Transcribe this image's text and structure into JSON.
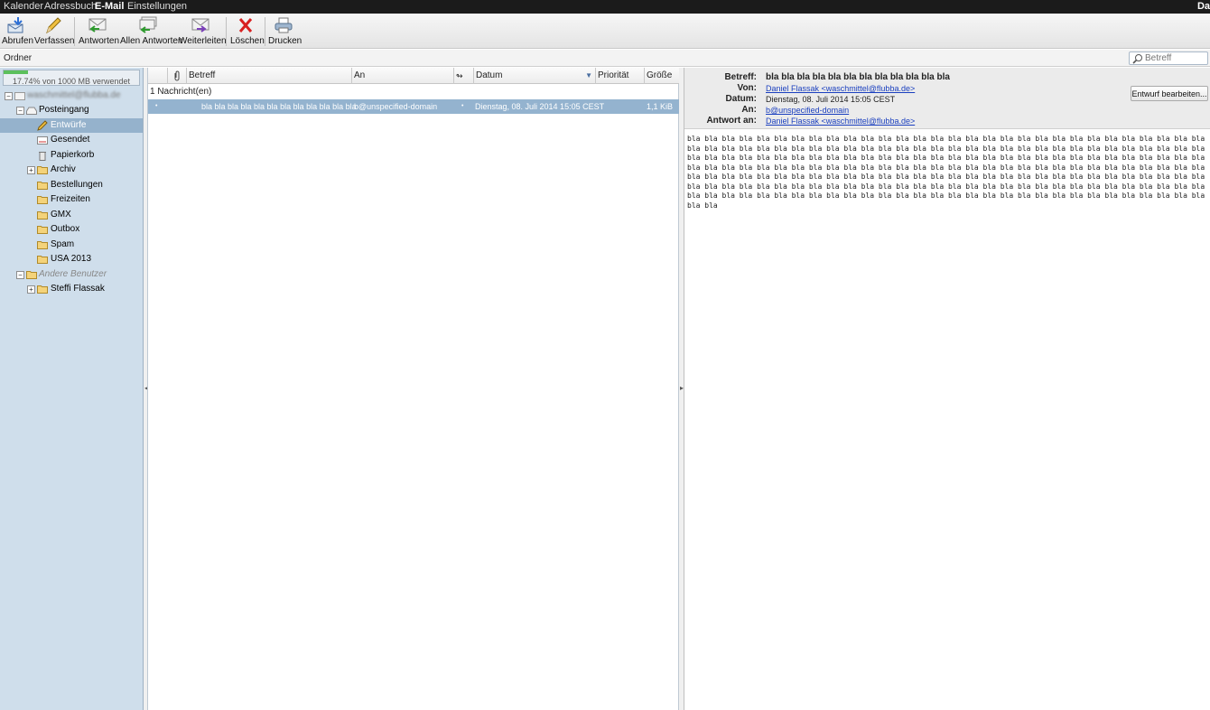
{
  "topnav": {
    "items": [
      "Kalender",
      "Adressbuch",
      "E-Mail",
      "Einstellungen"
    ],
    "active_index": 2,
    "right_text": "Da"
  },
  "toolbar": {
    "buttons": [
      {
        "label": "Abrufen",
        "icon": "fetch-mail-icon"
      },
      {
        "label": "Verfassen",
        "icon": "pencil-icon"
      },
      {
        "label": "Antworten",
        "icon": "reply-icon"
      },
      {
        "label": "Allen Antworten",
        "icon": "reply-all-icon"
      },
      {
        "label": "Weiterleiten",
        "icon": "forward-icon"
      },
      {
        "label": "Löschen",
        "icon": "delete-icon"
      },
      {
        "label": "Drucken",
        "icon": "print-icon"
      }
    ]
  },
  "ordnerbar": {
    "label": "Ordner",
    "search_placeholder": "Betreff"
  },
  "sidebar": {
    "quota_text": "17.74% von 1000 MB verwendet",
    "quota_fraction": 0.1774,
    "account": "waschmittel@flubba.de",
    "folders": [
      {
        "label": "Posteingang",
        "icon": "inbox-icon"
      },
      {
        "label": "Entwürfe",
        "icon": "drafts-icon",
        "selected": true
      },
      {
        "label": "Gesendet",
        "icon": "sent-icon"
      },
      {
        "label": "Papierkorb",
        "icon": "trash-icon"
      },
      {
        "label": "Archiv",
        "icon": "folder-icon",
        "expandable": true
      },
      {
        "label": "Bestellungen",
        "icon": "folder-icon"
      },
      {
        "label": "Freizeiten",
        "icon": "folder-icon"
      },
      {
        "label": "GMX",
        "icon": "folder-icon"
      },
      {
        "label": "Outbox",
        "icon": "folder-icon"
      },
      {
        "label": "Spam",
        "icon": "folder-icon"
      },
      {
        "label": "USA 2013",
        "icon": "folder-icon"
      }
    ],
    "other_users_label": "Andere Benutzer",
    "other_users": [
      {
        "label": "Steffi Flassak",
        "icon": "folder-icon",
        "expandable": true
      }
    ]
  },
  "list": {
    "columns": [
      "Betreff",
      "An",
      "Datum",
      "Priorität",
      "Größe"
    ],
    "count_text": "1 Nachricht(en)",
    "rows": [
      {
        "subject": "bla bla bla bla bla bla bla bla bla bla bla bla",
        "to": "b@unspecified-domain",
        "date": "Dienstag, 08. Juli 2014 15:05 CEST",
        "priority": "",
        "size": "1,1 KiB"
      }
    ]
  },
  "preview": {
    "labels": {
      "subject": "Betreff:",
      "from": "Von:",
      "date": "Datum:",
      "to": "An:",
      "reply_to": "Antwort an:"
    },
    "subject": "bla bla bla bla bla bla bla bla bla bla bla bla",
    "from": "Daniel Flassak <waschmittel@flubba.de>",
    "date": "Dienstag, 08. Juli 2014 15:05 CEST",
    "to": "b@unspecified-domain",
    "reply_to": "Daniel Flassak <waschmittel@flubba.de>",
    "edit_button": "Entwurf bearbeiten...",
    "body": "bla bla bla bla bla bla bla bla bla bla bla bla bla bla bla bla bla bla bla bla bla bla bla bla bla bla bla bla bla bla bla bla bla bla bla bla bla bla bla bla bla bla bla bla bla bla bla bla bla bla bla bla bla bla bla bla bla bla bla bla bla bla bla bla bla bla bla bla bla bla bla bla bla bla bla bla bla bla bla bla bla bla bla bla bla bla bla bla bla bla bla bla bla bla bla bla bla bla bla bla bla bla bla bla bla bla bla bla bla bla bla bla bla bla bla bla bla bla bla bla bla bla bla bla bla bla bla bla bla bla bla bla bla bla bla bla bla bla bla bla bla bla bla bla bla bla bla bla bla bla bla bla bla bla bla bla bla bla bla bla bla bla bla bla bla bla bla bla bla bla bla bla bla bla bla bla bla bla bla bla bla bla bla bla bla bla bla bla bla bla bla bla bla bla bla bla bla bla bla bla bla bla bla bla bla bla bla bla bla bla bla bla"
  },
  "colors": {
    "selected": "#95b2cc",
    "sidebar_bg": "#cfdeeb",
    "link": "#1a3fbf"
  }
}
